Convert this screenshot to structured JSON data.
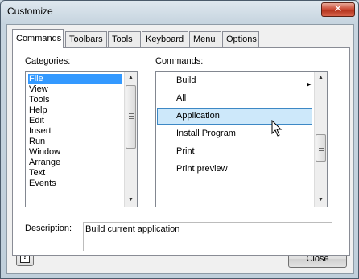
{
  "window": {
    "title": "Customize",
    "close_icon": "close-icon"
  },
  "tabs": [
    {
      "label": "Commands",
      "active": true
    },
    {
      "label": "Toolbars",
      "active": false
    },
    {
      "label": "Tools",
      "active": false
    },
    {
      "label": "Keyboard",
      "active": false
    },
    {
      "label": "Menu",
      "active": false
    },
    {
      "label": "Options",
      "active": false
    }
  ],
  "categories": {
    "label": "Categories:",
    "items": [
      "File",
      "View",
      "Tools",
      "Help",
      "Edit",
      "Insert",
      "Run",
      "Window",
      "Arrange",
      "Text",
      "Events"
    ],
    "selected": "File"
  },
  "commands": {
    "label": "Commands:",
    "items": [
      "Build",
      "All",
      "Application",
      "Install Program",
      "Print",
      "Print preview"
    ],
    "selected": "Application"
  },
  "description": {
    "label": "Description:",
    "text": "Build current application"
  },
  "buttons": {
    "help_icon": "help-icon",
    "help_glyph": "?",
    "close_label": "Close"
  }
}
